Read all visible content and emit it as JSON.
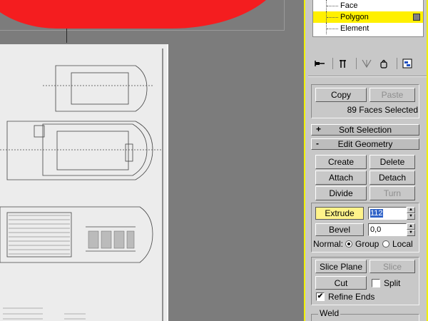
{
  "subobject_list": {
    "items": [
      {
        "label": "Face",
        "selected": false
      },
      {
        "label": "Polygon",
        "selected": true
      },
      {
        "label": "Element",
        "selected": false
      }
    ]
  },
  "toolbar_icons": [
    "pin-stack-icon",
    "show-end-result-icon",
    "make-unique-icon",
    "remove-modifier-icon",
    "configure-sets-icon"
  ],
  "selection": {
    "copy_label": "Copy",
    "paste_label": "Paste",
    "status": "89 Faces Selected"
  },
  "rollouts": {
    "soft_selection": {
      "sign": "+",
      "label": "Soft Selection"
    },
    "edit_geometry": {
      "sign": "-",
      "label": "Edit Geometry"
    }
  },
  "edit_geometry": {
    "create": "Create",
    "delete": "Delete",
    "attach": "Attach",
    "detach": "Detach",
    "divide": "Divide",
    "turn": "Turn",
    "extrude_label": "Extrude",
    "extrude_value": "112",
    "bevel_label": "Bevel",
    "bevel_value": "0,0",
    "normal_label": "Normal:",
    "group_label": "Group",
    "local_label": "Local",
    "normal_selected": "Group",
    "slice_plane": "Slice Plane",
    "slice": "Slice",
    "cut": "Cut",
    "split_label": "Split",
    "split_checked": false,
    "refine_ends_label": "Refine Ends",
    "refine_ends_checked": true,
    "check_mark": "✔",
    "weld_label": "Weld"
  },
  "colors": {
    "panel_border": "#f0f000",
    "selected_row": "#fff000",
    "viewport_bg": "#7c7c7c",
    "red_object": "#f41d1f",
    "value_highlight": "#3063c8"
  }
}
